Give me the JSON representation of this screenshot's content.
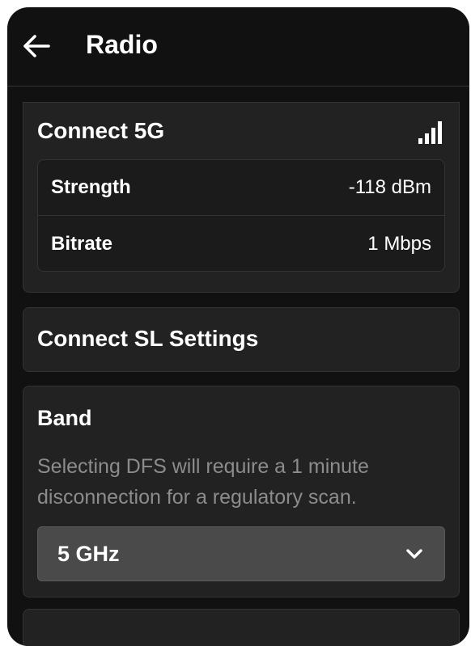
{
  "header": {
    "title": "Radio",
    "back_icon": "arrow-left-icon"
  },
  "connect_5g": {
    "title": "Connect 5G",
    "signal_icon": "signal-bars-icon",
    "stats": [
      {
        "label": "Strength",
        "value": "-118 dBm"
      },
      {
        "label": "Bitrate",
        "value": "1 Mbps"
      }
    ]
  },
  "connect_sl": {
    "title": "Connect SL Settings"
  },
  "band": {
    "title": "Band",
    "description": "Selecting DFS will require a 1 minute disconnection for a regulatory scan.",
    "selected": "5 GHz",
    "dropdown_icon": "chevron-down-icon"
  },
  "colors": {
    "background": "#111111",
    "card": "#222222",
    "select": "#4a4a4a",
    "muted_text": "#8c8c8c"
  }
}
